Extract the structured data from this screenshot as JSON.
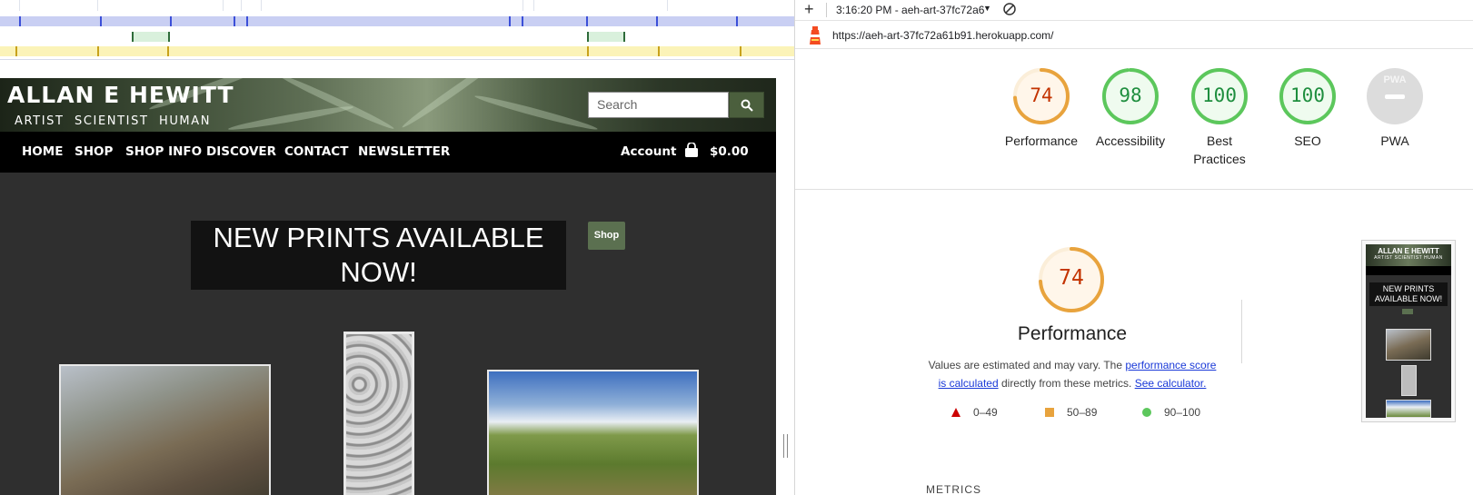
{
  "site": {
    "title": "ALLAN E HEWITT",
    "subtitle": "ARTIST  SCIENTIST  HUMAN",
    "search_placeholder": "Search",
    "nav": [
      "HOME",
      "SHOP",
      "SHOP INFO",
      "DISCOVER",
      "CONTACT",
      "NEWSLETTER"
    ],
    "account_label": "Account",
    "cart_total": "$0.00",
    "hero_text": "NEW PRINTS AVAILABLE NOW!",
    "shop_button": "Shop"
  },
  "devtools": {
    "report_label": "3:16:20 PM - aeh-art-37fc72a6",
    "url": "https://aeh-art-37fc72a61b91.herokuapp.com/",
    "colors": {
      "fail": "#cc0000",
      "average": "#e8a33d",
      "pass": "#1e8e3e",
      "pass_ring": "#5cc75c",
      "average_text": "#c33300"
    },
    "categories": [
      {
        "label": "Performance",
        "score": "74",
        "value": 74,
        "rating": "average"
      },
      {
        "label": "Accessibility",
        "score": "98",
        "value": 98,
        "rating": "pass"
      },
      {
        "label": "Best Practices",
        "score": "100",
        "value": 100,
        "rating": "pass"
      },
      {
        "label": "SEO",
        "score": "100",
        "value": 100,
        "rating": "pass"
      },
      {
        "label": "PWA",
        "score": "",
        "value": 0,
        "rating": "na",
        "badge": "PWA"
      }
    ],
    "performance": {
      "score": "74",
      "title": "Performance",
      "desc_prefix": "Values are estimated and may vary. The ",
      "desc_link1": "performance score is calculated",
      "desc_middle": " directly from these metrics. ",
      "desc_link2": "See calculator."
    },
    "legend": [
      {
        "range": "0–49",
        "shape": "triangle",
        "color": "#cc0000"
      },
      {
        "range": "50–89",
        "shape": "square",
        "color": "#e8a33d"
      },
      {
        "range": "90–100",
        "shape": "circle",
        "color": "#5cc75c"
      }
    ],
    "metrics_label": "METRICS",
    "thumbnail": {
      "title": "ALLAN E HEWITT",
      "subtitle": "ARTIST SCIENTIST HUMAN",
      "hero": "NEW PRINTS AVAILABLE NOW!"
    },
    "icons": [
      "plus-icon",
      "caret-down-icon",
      "block-icon",
      "lighthouse-icon",
      "search-icon",
      "cart-icon"
    ]
  }
}
